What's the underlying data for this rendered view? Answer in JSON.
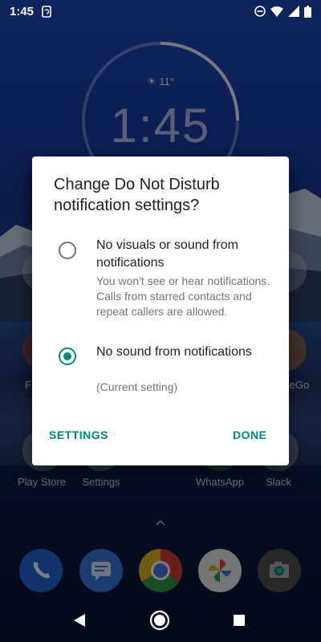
{
  "status_bar": {
    "time": "1:45"
  },
  "home": {
    "weather": "11°",
    "clock": "1:45",
    "row1_labels": [
      "F",
      "eGo"
    ],
    "row2_labels": [
      "Play Store",
      "Settings",
      "WhatsApp",
      "Slack"
    ]
  },
  "dialog": {
    "title": "Change Do Not Disturb notification settings?",
    "options": [
      {
        "label": "No visuals or sound from notifications",
        "description": "You won't see or hear notifications. Calls from starred contacts and repeat callers are allowed.",
        "selected": false
      },
      {
        "label": "No sound from notifications",
        "description": "(Current setting)",
        "selected": true
      }
    ],
    "settings_button": "SETTINGS",
    "done_button": "DONE"
  },
  "colors": {
    "accent": "#00897b"
  }
}
